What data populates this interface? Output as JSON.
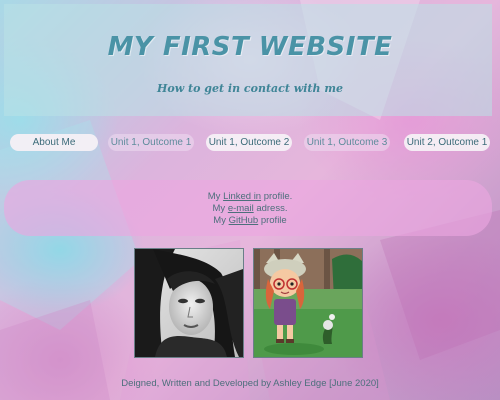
{
  "header": {
    "title": "MY FIRST WEBSITE",
    "subtitle": "How to get in contact with me"
  },
  "nav": {
    "items": [
      {
        "label": "About Me"
      },
      {
        "label": "Unit 1, Outcome 1"
      },
      {
        "label": "Unit 1, Outcome 2"
      },
      {
        "label": "Unit 1, Outcome 3"
      },
      {
        "label": "Unit 2, Outcome 1"
      }
    ]
  },
  "contact": {
    "line1_prefix": "My ",
    "line1_link": "Linked in",
    "line1_suffix": " profile.",
    "line2_prefix": "My ",
    "line2_link": "e-mail",
    "line2_suffix": " adress.",
    "line3_prefix": "My ",
    "line3_link": "GitHub",
    "line3_suffix": " profile"
  },
  "footer": {
    "credit": "Deigned, Written and Developed by Ashley Edge [June 2020]"
  },
  "colors": {
    "title": "#4a93a6",
    "text": "#4d6f7c",
    "contact_bg": "#eca6e0"
  }
}
